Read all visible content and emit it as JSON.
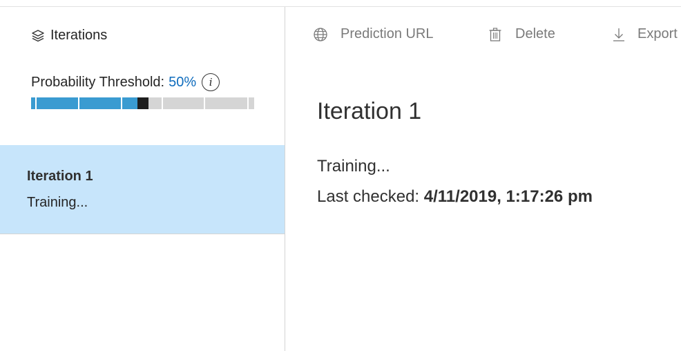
{
  "sidebar": {
    "header_label": "Iterations",
    "threshold_label": "Probability Threshold:",
    "threshold_value": "50%",
    "threshold_fraction": 0.5,
    "info_glyph": "i",
    "iterations": [
      {
        "name": "Iteration 1",
        "status": "Training..."
      }
    ]
  },
  "toolbar": {
    "prediction_url_label": "Prediction URL",
    "delete_label": "Delete",
    "export_label": "Export"
  },
  "main": {
    "title": "Iteration 1",
    "status": "Training...",
    "last_checked_label": "Last checked:",
    "last_checked_value": "4/11/2019, 1:17:26 pm"
  },
  "colors": {
    "accent": "#0f6cbd",
    "slider_fill": "#3a9bd1",
    "slider_track": "#d5d5d5",
    "selected_row": "#c7e5fb"
  },
  "icons": {
    "iterations": "layers-icon",
    "info": "info-icon",
    "prediction_url": "globe-icon",
    "delete": "trash-icon",
    "export": "download-icon"
  }
}
